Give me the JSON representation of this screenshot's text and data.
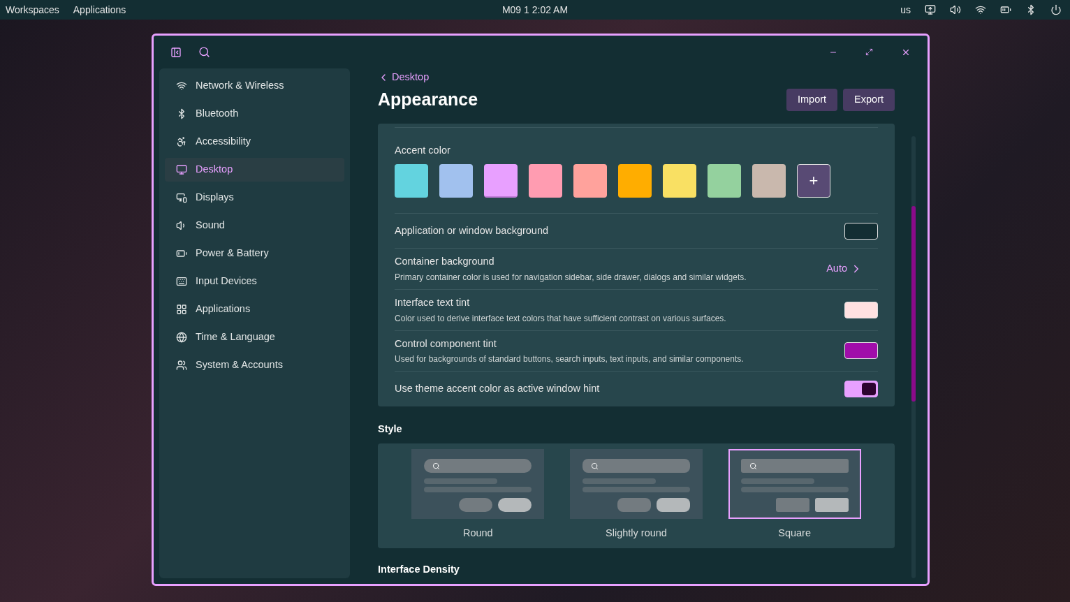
{
  "top_bar": {
    "left": [
      "Workspaces",
      "Applications"
    ],
    "clock": "M09 1 2:02 AM",
    "keyboard_layout": "us"
  },
  "sidebar": {
    "items": [
      {
        "label": "Network & Wireless",
        "selected": false
      },
      {
        "label": "Bluetooth",
        "selected": false
      },
      {
        "label": "Accessibility",
        "selected": false
      },
      {
        "label": "Desktop",
        "selected": true
      },
      {
        "label": "Displays",
        "selected": false
      },
      {
        "label": "Sound",
        "selected": false
      },
      {
        "label": "Power & Battery",
        "selected": false
      },
      {
        "label": "Input Devices",
        "selected": false
      },
      {
        "label": "Applications",
        "selected": false
      },
      {
        "label": "Time & Language",
        "selected": false
      },
      {
        "label": "System & Accounts",
        "selected": false
      }
    ]
  },
  "page": {
    "back_label": "Desktop",
    "title": "Appearance",
    "buttons": [
      "Import",
      "Export"
    ]
  },
  "accent": {
    "label": "Accent color",
    "swatches": [
      {
        "color": "#63d3df",
        "selected": false
      },
      {
        "color": "#a1c1ee",
        "selected": false
      },
      {
        "color": "#e8a0ff",
        "selected": true
      },
      {
        "color": "#ff9cb1",
        "selected": false
      },
      {
        "color": "#ffa29c",
        "selected": false
      },
      {
        "color": "#ffad00",
        "selected": false
      },
      {
        "color": "#f9e063",
        "selected": false
      },
      {
        "color": "#94d19e",
        "selected": false
      },
      {
        "color": "#c9b8ad",
        "selected": false
      }
    ],
    "add": "+"
  },
  "settings": [
    {
      "kind": "color",
      "label": "Application or window background",
      "color": "#132e33"
    },
    {
      "kind": "link",
      "label": "Container background",
      "description": "Primary container color is used for navigation sidebar, side drawer, dialogs and similar widgets.",
      "value": "Auto"
    },
    {
      "kind": "color",
      "label": "Interface text tint",
      "description": "Color used to derive interface text colors that have sufficient contrast on various surfaces.",
      "color": "#ffe1e1"
    },
    {
      "kind": "color",
      "label": "Control component tint",
      "description": "Used for backgrounds of standard buttons, search inputs, text inputs, and similar components.",
      "color": "#a00daa"
    },
    {
      "kind": "toggle",
      "label": "Use theme accent color as active window hint",
      "on": true
    }
  ],
  "style": {
    "heading": "Style",
    "options": [
      {
        "label": "Round",
        "selected": false
      },
      {
        "label": "Slightly round",
        "selected": false
      },
      {
        "label": "Square",
        "selected": true
      }
    ]
  },
  "next_heading": "Interface Density"
}
